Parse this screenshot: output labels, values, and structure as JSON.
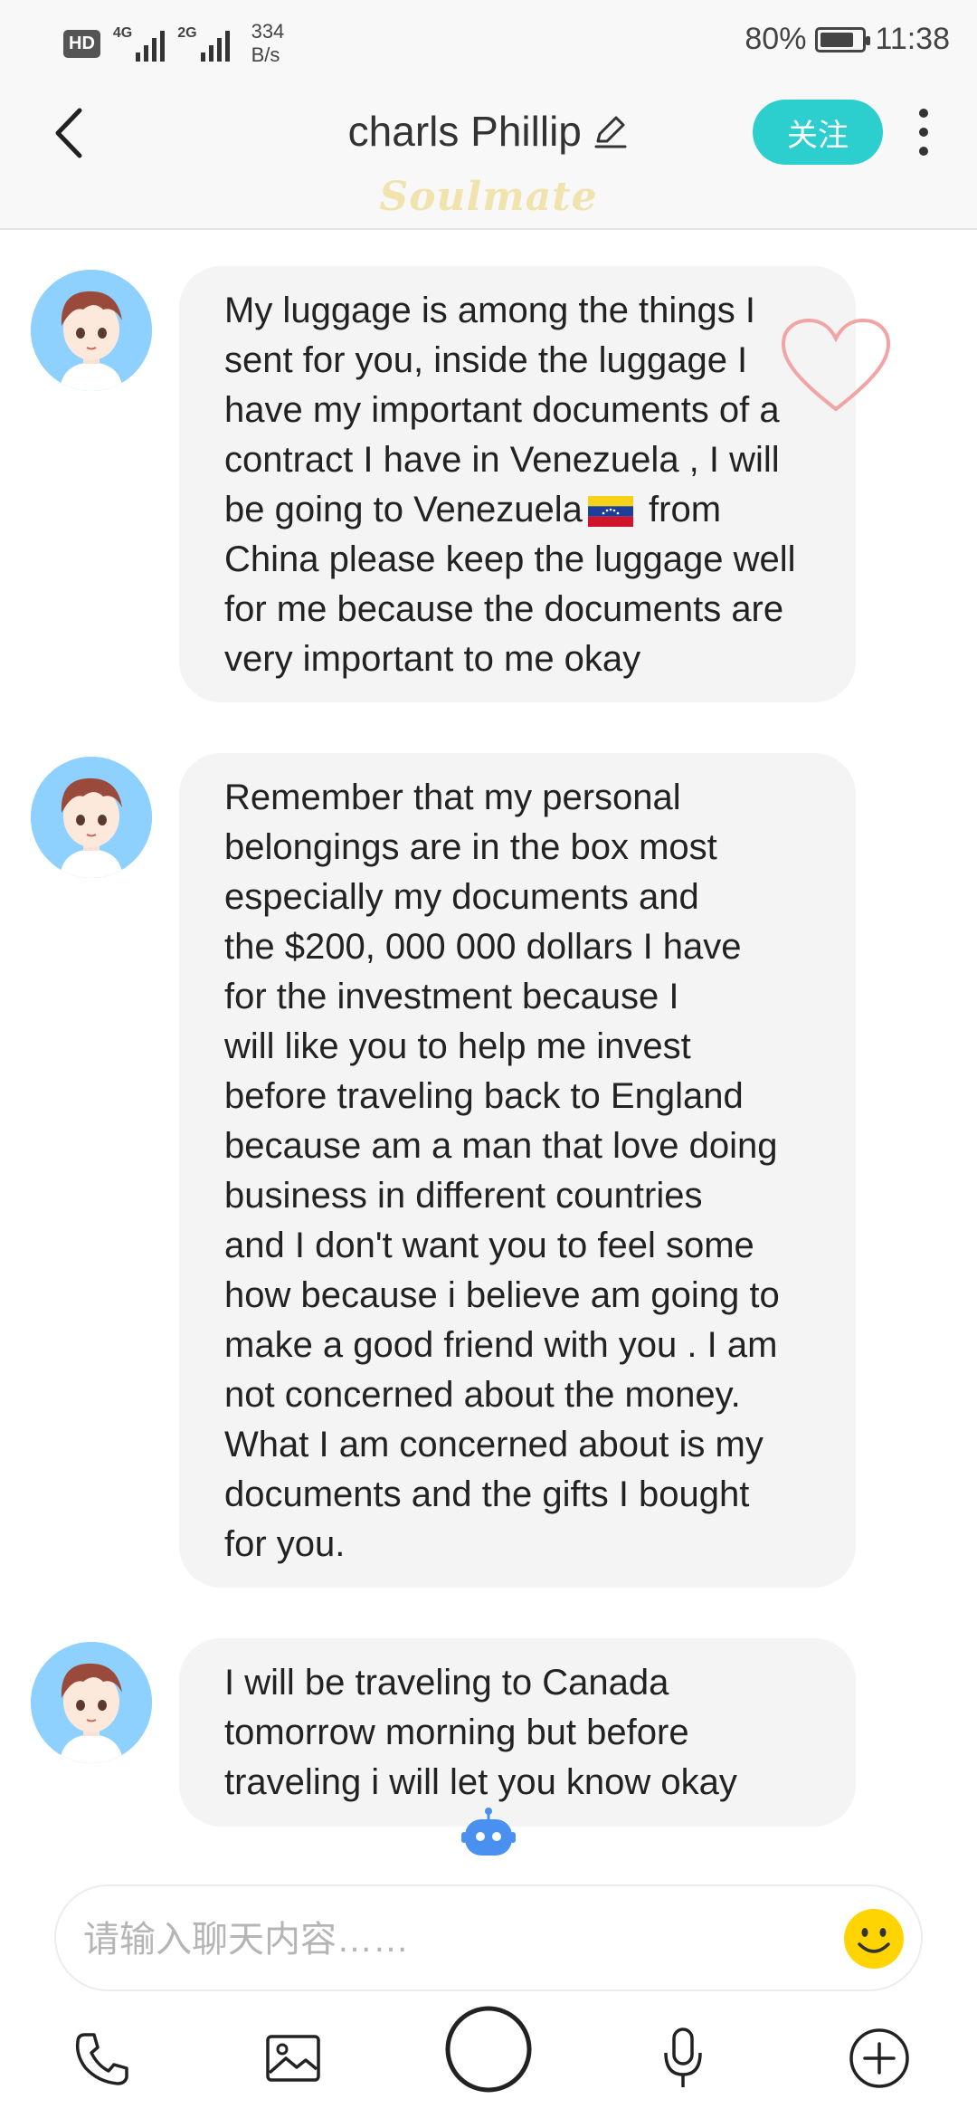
{
  "status_bar": {
    "hd": "HD",
    "sig1_label": "4G",
    "sig2_label": "2G",
    "speed_value": "334",
    "speed_unit": "B/s",
    "battery": "80%",
    "battery_level": 0.8,
    "time": "11:38"
  },
  "header": {
    "title": "charls Phillip",
    "follow_label": "关注",
    "brand": "Soulmate"
  },
  "messages": [
    {
      "text": "My luggage is among the things I\nsent for you, inside the luggage  I\nhave my important  documents of a\ncontract I have in Venezuela , I will\nbe going to Venezuela",
      "text_after_flag": "   from\nChina please keep the luggage well\nfor me because the documents are\nvery important to me okay",
      "flag_icon": "venezuela-flag"
    },
    {
      "text": "Remember that my personal\nbelongings are in the box most\nespecially my documents and\nthe $200, 000 000 dollars I have\nfor the investment because I\nwill like you to help me invest\nbefore traveling back to England\nbecause am a man that love doing\nbusiness in different countries\nand I don't want you to feel some\nhow because i believe am going to\nmake a good friend with you .  I am\nnot concerned about the money.\nWhat I am concerned about is my\ndocuments and the gifts I bought\nfor you."
    },
    {
      "text": "I will be traveling to Canada\ntomorrow morning but before\ntraveling i will let you know okay"
    }
  ],
  "input": {
    "placeholder": "请输入聊天内容……"
  },
  "colors": {
    "accent": "#2ccfcd",
    "bubble": "#f4f4f4",
    "heart": "#f2a3a3",
    "avatar_bg": "#8ed1ff",
    "bot": "#4a90f0",
    "emoji": "#ffd400"
  },
  "icons": [
    "back-arrow-icon",
    "edit-pencil-icon",
    "more-dots-icon",
    "heart-icon",
    "robot-icon",
    "smiley-icon",
    "phone-icon",
    "image-icon",
    "camera-shutter-icon",
    "microphone-icon",
    "plus-icon"
  ]
}
